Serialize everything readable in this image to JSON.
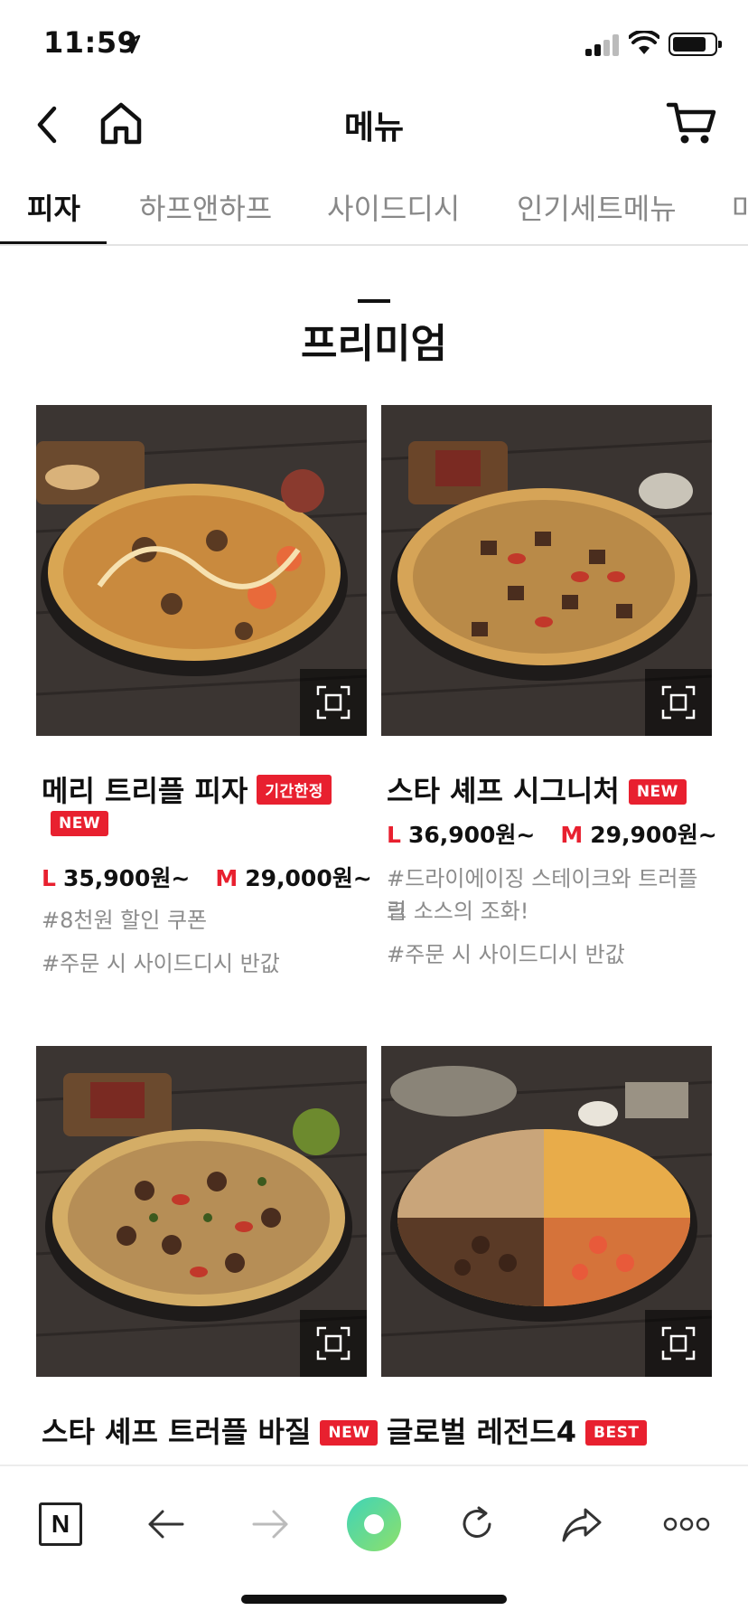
{
  "status_bar": {
    "time": "11:59"
  },
  "nav": {
    "title": "메뉴"
  },
  "tabs": [
    {
      "label": "피자"
    },
    {
      "label": "하프앤하프"
    },
    {
      "label": "사이드디시"
    },
    {
      "label": "인기세트메뉴"
    },
    {
      "label": "마"
    }
  ],
  "section": {
    "title": "프리미엄"
  },
  "products": [
    {
      "name": "메리 트리플 피자",
      "badges": [
        "기간한정",
        "NEW"
      ],
      "price_l_size": "L",
      "price_l": "35,900원~",
      "price_m_size": "M",
      "price_m": "29,000원~",
      "tags": [
        "#8천원 할인 쿠폰",
        "#주문 시 사이드디시 반값"
      ]
    },
    {
      "name": "스타 셰프 시그니처",
      "badges": [
        "NEW"
      ],
      "price_l_size": "L",
      "price_l": "36,900원~",
      "price_m_size": "M",
      "price_m": "29,900원~",
      "tags": [
        "#드라이에이징 스테이크와 트러플 크",
        "림 소스의 조화!",
        "#주문 시 사이드디시 반값"
      ]
    },
    {
      "name": "스타 셰프 트러플 바질",
      "badges": [
        "NEW"
      ]
    },
    {
      "name": "글로벌 레전드4",
      "badges": [
        "BEST"
      ]
    }
  ],
  "icons": {
    "back": "chevron-left-icon",
    "home": "home-icon",
    "cart": "cart-icon",
    "zoom": "zoom-frame-icon",
    "naver": "naver-n-icon",
    "browser_back": "arrow-left-icon",
    "browser_forward": "arrow-right-icon",
    "green_dot": "green-dot-icon",
    "reload": "reload-icon",
    "share": "share-icon",
    "more": "more-dots-icon"
  },
  "colors": {
    "accent": "#e8202f",
    "tag_text": "#8c8c8c"
  }
}
